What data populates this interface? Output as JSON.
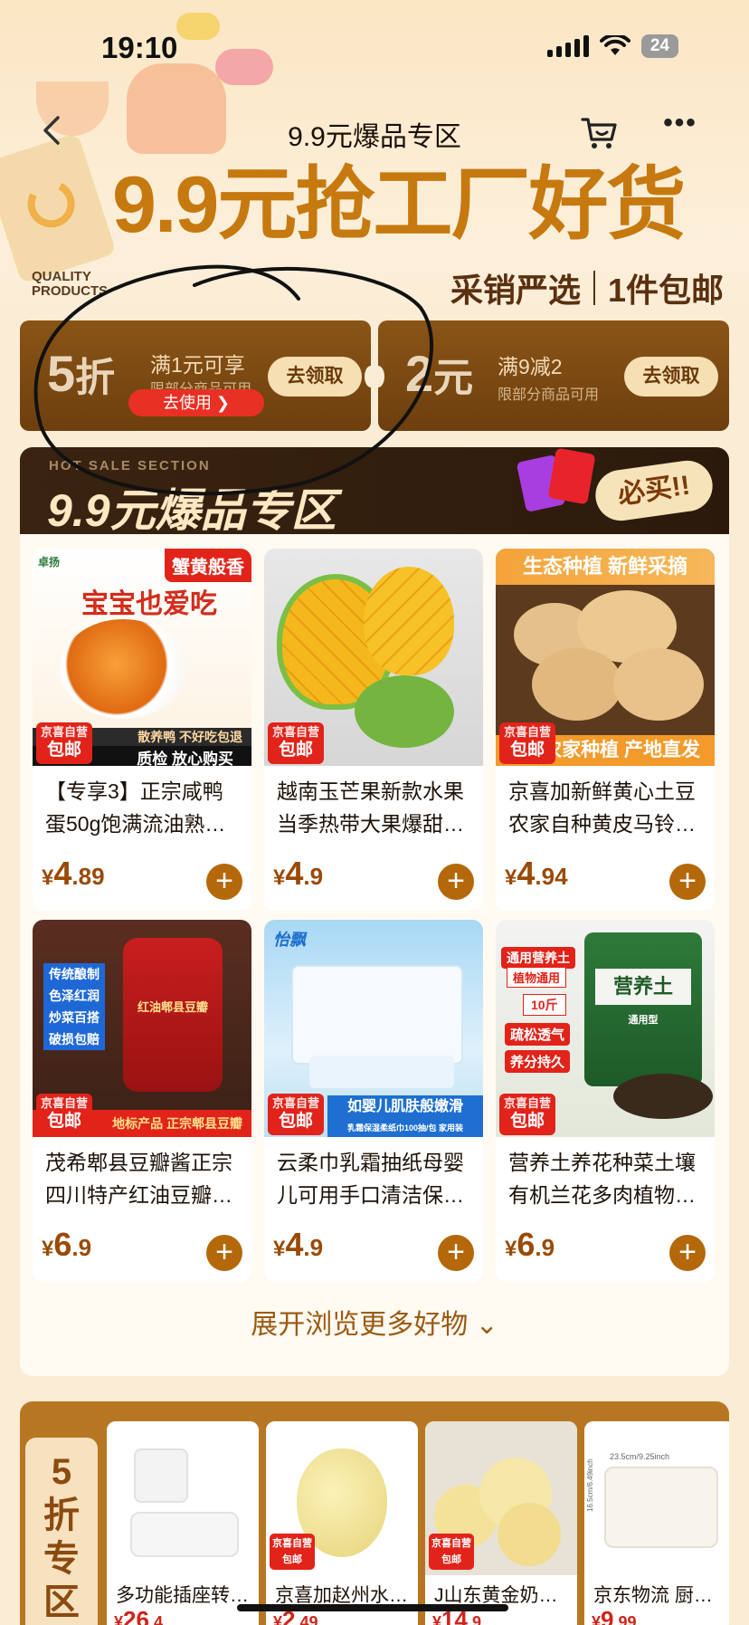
{
  "status_bar": {
    "time": "19:10",
    "battery": "24"
  },
  "nav": {
    "title": "9.9元爆品专区"
  },
  "hero": {
    "headline": "9.9元抢工厂好货",
    "quality_line1": "QUALITY",
    "quality_line2": "PRODUCTS",
    "tagline_left": "采销严选",
    "tagline_right": "1件包邮"
  },
  "coupons": [
    {
      "value": "5",
      "unit": "折",
      "condition": "满1元可享",
      "subtext": "限部分商品可用",
      "claim": "去领取",
      "use": "去使用 ❯"
    },
    {
      "value": "2",
      "unit": "元",
      "condition": "满9减2",
      "subtext": "限部分商品可用",
      "claim": "去领取"
    }
  ],
  "hot_section": {
    "title_en": "HOT SALE SECTION",
    "title": "9.9元爆品专区",
    "must_buy": "必买!!"
  },
  "jd_badge": {
    "line1": "京喜自营",
    "line2": "包邮"
  },
  "products": [
    {
      "name": "【专享3】正宗咸鸭蛋50g饱满流油熟…",
      "price_int": "4",
      "price_dec": ".89",
      "banner_top": "蟹黄般香",
      "banner_mid": "宝宝也爱吃",
      "banner_bottom": "散养鸭 不好吃包退",
      "banner_bottom2": "质检 放心购买",
      "brand": "卓扬"
    },
    {
      "name": "越南玉芒果新款水果当季热带大果爆甜…",
      "price_int": "4",
      "price_dec": ".9"
    },
    {
      "name": "京喜加新鲜黄心土豆农家自种黄皮马铃…",
      "price_int": "4",
      "price_dec": ".94",
      "banner_top": "生态种植 新鲜采摘",
      "banner_bottom": "农家种植 产地直发"
    },
    {
      "name": "茂希郫县豆瓣酱正宗四川特产红油豆瓣…",
      "price_int": "6",
      "price_dec": ".9",
      "tags": [
        "传统酿制",
        "色泽红润",
        "炒菜百搭",
        "破损包赔"
      ],
      "banner_bottom": "地标产品 正宗郫县豆瓣",
      "jar_label": "红油郫县豆瓣"
    },
    {
      "name": "云柔巾乳霜抽纸母婴儿可用手口清洁保…",
      "price_int": "4",
      "price_dec": ".9",
      "brand": "怡飘",
      "banner_top": "如婴儿肌肤般嫩滑",
      "banner_sub": "乳霜保湿柔纸巾100抽/包 家用装"
    },
    {
      "name": "营养土养花种菜土壤有机兰花多肉植物…",
      "price_int": "6",
      "price_dec": ".9",
      "tags": [
        "通用营养土",
        "植物通用",
        "10斤",
        "疏松透气",
        "养分持久"
      ],
      "bag_label": "营养土",
      "bag_sub": "通用型"
    }
  ],
  "expand": "展开浏览更多好物 ⌄",
  "discount_zone": {
    "label": "5折专区",
    "items": [
      {
        "name": "多功能插座转…",
        "price_int": "26",
        "price_dec": ".4"
      },
      {
        "name": "京喜加赵州水…",
        "price_int": "2",
        "price_dec": ".49"
      },
      {
        "name": "J山东黄金奶…",
        "price_int": "14",
        "price_dec": ".9"
      },
      {
        "name": "京东物流 厨…",
        "price_int": "9",
        "price_dec": ".99",
        "dim_top": "23.5cm/9.25inch",
        "dim_side": "16.5cm/6.49inch"
      }
    ]
  },
  "colors": {
    "accent": "#c6790f",
    "dark_brown": "#2b1a0c",
    "jd_red": "#e2231a",
    "price": "#9a4a06",
    "page_bg": "#fbecd6"
  },
  "icons": [
    "back-icon",
    "cart-icon",
    "more-icon",
    "add-icon",
    "chevron-down-icon",
    "wifi-icon",
    "signal-icon",
    "battery-icon"
  ]
}
